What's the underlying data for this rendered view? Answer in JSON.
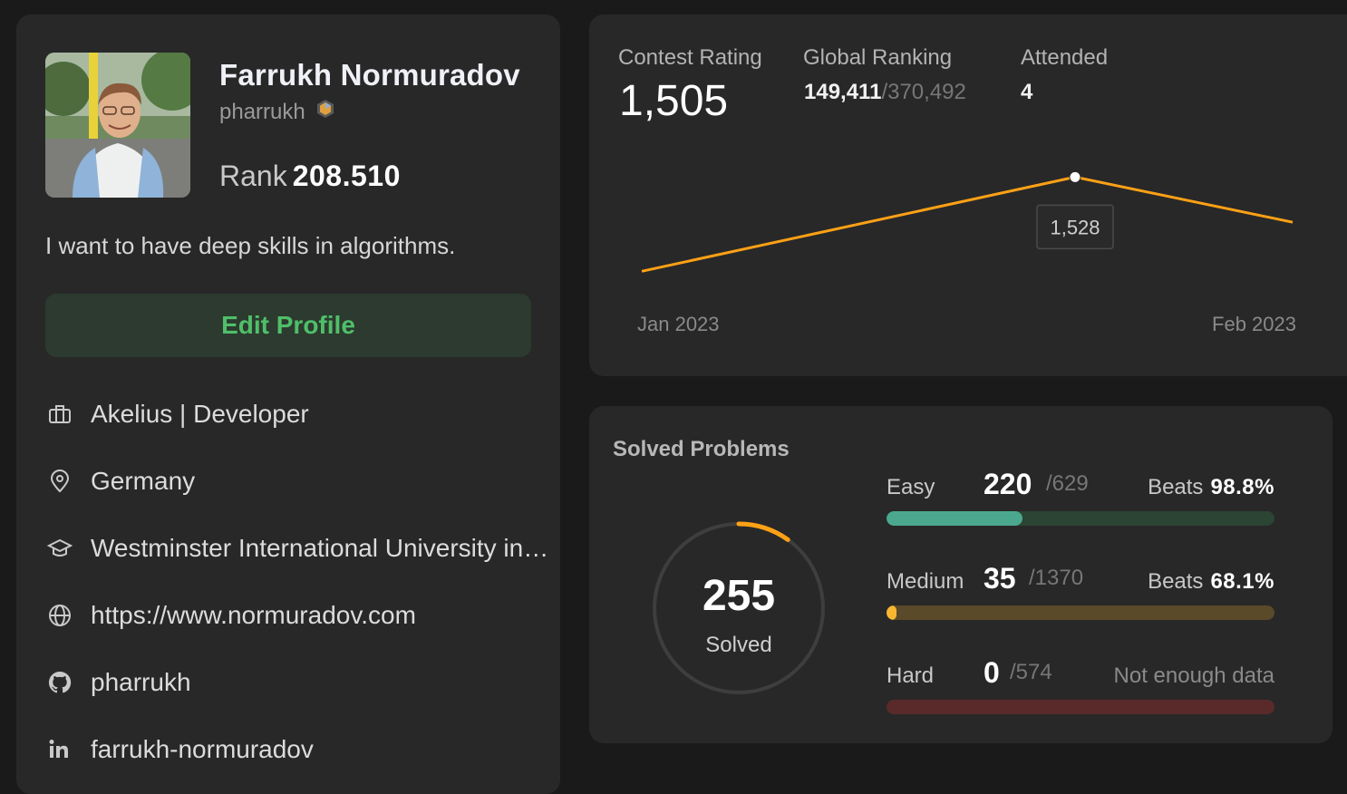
{
  "profile": {
    "name": "Farrukh Normuradov",
    "username": "pharrukh",
    "rank_label": "Rank",
    "rank_value": "208.510",
    "bio": "I want to have deep skills in algorithms.",
    "edit_button": "Edit Profile",
    "info": [
      {
        "icon": "briefcase-icon",
        "text": "Akelius | Developer"
      },
      {
        "icon": "location-pin-icon",
        "text": "Germany"
      },
      {
        "icon": "graduation-cap-icon",
        "text": "Westminster International University in Tashkent"
      },
      {
        "icon": "globe-icon",
        "text": "https://www.normuradov.com"
      },
      {
        "icon": "github-icon",
        "text": "pharrukh"
      },
      {
        "icon": "linkedin-icon",
        "text": "farrukh-normuradov"
      }
    ]
  },
  "contest": {
    "rating_label": "Contest Rating",
    "rating": "1,505",
    "global_label": "Global Ranking",
    "global_rank": "149,411",
    "global_total": "/370,492",
    "attended_label": "Attended",
    "attended": "4",
    "chart_data": {
      "type": "line",
      "x_labels": [
        "Jan 2023",
        "Feb 2023"
      ],
      "values": [
        1480,
        1528,
        1505
      ],
      "highlight_index": 1,
      "tooltip": "1,528",
      "color": "#ffa116",
      "ylim": [
        1440,
        1560
      ]
    }
  },
  "solved": {
    "title": "Solved Problems",
    "total": "255",
    "total_label": "Solved",
    "solved_count": 255,
    "total_count": 2573,
    "ring_color": "#ffa116",
    "difficulties": [
      {
        "name": "Easy",
        "solved": "220",
        "total": "/629",
        "beats_label": "Beats",
        "beats": "98.8%",
        "fraction": 0.35,
        "color": "#2cbb5d",
        "fill": "#4ba88f",
        "track": "#2b4433"
      },
      {
        "name": "Medium",
        "solved": "35",
        "total": "/1370",
        "beats_label": "Beats",
        "beats": "68.1%",
        "fraction": 0.026,
        "color": "#ffc01e",
        "fill": "#f7b731",
        "track": "#5a4a2a"
      },
      {
        "name": "Hard",
        "solved": "0",
        "total": "/574",
        "beats_label": "Not enough data",
        "beats": "",
        "fraction": 0,
        "color": "#ef4743",
        "fill": "#ef4743",
        "track": "#5a2a2a"
      }
    ]
  }
}
